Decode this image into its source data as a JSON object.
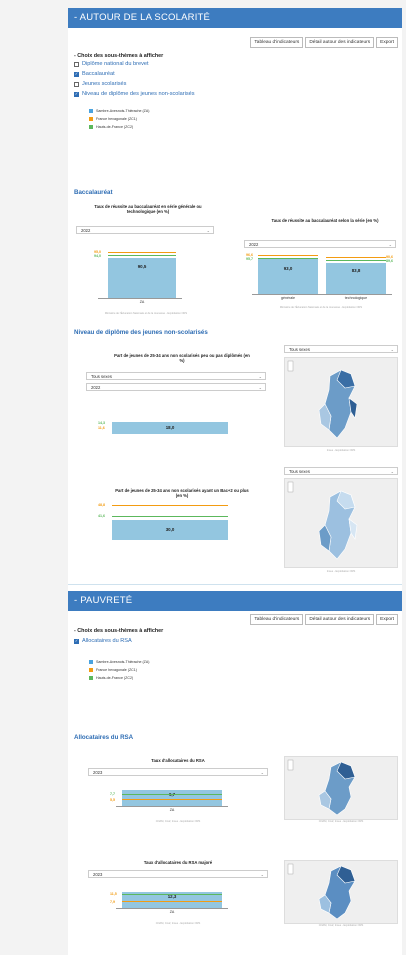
{
  "colors": {
    "band": "#3d7cc0",
    "zone_za": "#4aa3df",
    "zone_zc1": "#f39c12",
    "zone_zc2": "#5cb85c",
    "bar": "#93c6e0"
  },
  "scolarite": {
    "title": "- AUTOUR DE LA SCOLARITÉ",
    "buttons": [
      "Tableau d'indicateurs",
      "Détail autour des indicateurs",
      "Export"
    ],
    "choix_label": "- Choix des sous-thèmes à afficher",
    "checkboxes": [
      {
        "label": "Diplôme national du brevet",
        "checked": false
      },
      {
        "label": "Baccalauréat",
        "checked": true
      },
      {
        "label": "Jeunes scolarisés",
        "checked": false
      },
      {
        "label": "Niveau de diplôme des jeunes non-scolarisés",
        "checked": true
      }
    ],
    "legend": [
      "Sambre-Avesnois-Thiérache (ZA)",
      "France hexagonale (ZC1)",
      "Hauts-de-France (ZC2)"
    ]
  },
  "bac": {
    "heading": "Baccalauréat",
    "chart1": {
      "title": "Taux de réussite au baccalauréat en série générale ou technologique (en %)",
      "year": "2022",
      "za": "90,5",
      "zc1": "95,0",
      "zc2": "94,0",
      "zc1_pos": 0.95,
      "zc2_pos": 0.94,
      "za_pos": 0.905,
      "xlabel": "ZA",
      "source": "Ministère de l'Éducation Nationale et de la Jeunesse - Exploitation ORS"
    },
    "chart2": {
      "title": "Taux de réussite au baccalauréat selon la série (en %)",
      "year": "2022",
      "left_labels": [
        "96,6",
        "95,7"
      ],
      "right_labels": [
        "90,6",
        "89,6"
      ],
      "bars": [
        {
          "label": "générale",
          "value": "93,0"
        },
        {
          "label": "technologique",
          "value": "83,8"
        }
      ],
      "source": "Ministère de l'Éducation Nationale et de la Jeunesse - Exploitation ORS"
    }
  },
  "diplome": {
    "heading": "Niveau de diplôme des jeunes non-scolarisés",
    "chart1": {
      "title": "Part de jeunes de 25-34 ans non scolarisés peu ou pas diplômés (en %)",
      "filter": "Tous sexes",
      "year": "2022",
      "za": "18,0",
      "zc1": "11,6",
      "zc2": "14,3",
      "zc1_pos": 0.116,
      "zc2_pos": 0.143,
      "za_pos": 0.18
    },
    "chart2": {
      "title": "Part de jeunes de 25-34 ans non scolarisés ayant un Bac+2 ou plus (en %)",
      "za": "30,0",
      "zc1": "48,8",
      "zc2": "41,6",
      "zc1_pos": 0.488,
      "zc2_pos": 0.416,
      "za_pos": 0.3
    },
    "map_filter": "Tous sexes",
    "map_sources": [
      "Insee - Exploitation ORS",
      "Insee - Exploitation ORS"
    ]
  },
  "pauvrete": {
    "title": "- PAUVRETÉ",
    "buttons": [
      "Tableau d'indicateurs",
      "Détail autour des indicateurs",
      "Export"
    ],
    "choix_label": "- Choix des sous-thèmes à afficher",
    "checkboxes": [
      {
        "label": "Allocataires du RSA",
        "checked": true
      }
    ],
    "legend": [
      "Sambre-Avesnois-Thiérache (ZA)",
      "France hexagonale (ZC1)",
      "Hauts-de-France (ZC2)"
    ]
  },
  "rsa": {
    "heading": "Allocataires du RSA",
    "chart1": {
      "title": "Taux d'allocataires du RSA",
      "year": "2023",
      "za": "9,7",
      "zc1": "5,5",
      "zc2": "7,7",
      "zc1_pos": 0.055,
      "zc2_pos": 0.077,
      "za_pos": 0.097,
      "xlabel": "ZA",
      "source": "CNAM, Cnaf, Insee - Exploitation ORS"
    },
    "chart2": {
      "title": "Taux d'allocataires du RSA majoré",
      "year": "2023",
      "za": "12,3",
      "zc1": "7,9",
      "zc2": "11,5",
      "zc1_pos": 0.079,
      "zc2_pos": 0.115,
      "za_pos": 0.123,
      "xlabel": "ZA",
      "source": "CNAM, Cnaf, Insee - Exploitation ORS"
    },
    "map_sources": [
      "CNAM, Cnaf, Insee - Exploitation ORS",
      "CNAM, Cnaf, Insee - Exploitation ORS"
    ]
  }
}
